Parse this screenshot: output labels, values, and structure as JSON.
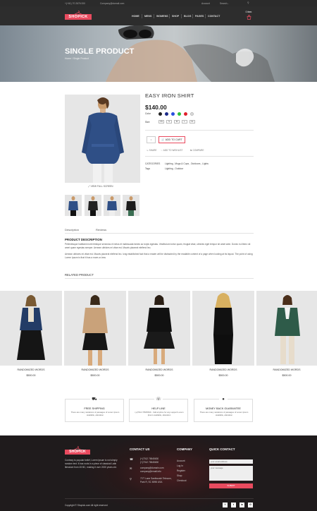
{
  "topbar": {
    "phone": "+(+61) 70 2676 000",
    "email": "Company@domail.com",
    "account": "Account",
    "search": "Search..."
  },
  "header": {
    "logo": "SHOPICK",
    "nav": [
      "HOME",
      "MENS",
      "WOMENS",
      "SHOP",
      "BLOG",
      "PAGES",
      "CONTACT"
    ],
    "cart_count": "0 item"
  },
  "hero": {
    "title": "SINGLE PRODUCT",
    "breadcrumb": "Home  /  Single Product"
  },
  "product": {
    "name": "EASY IRON SHIRT",
    "price": "$140.00",
    "color_label": "Color",
    "colors": [
      "#222222",
      "#1a2a88",
      "#2a4ee0",
      "#2cc23a",
      "#e0202a",
      "#dddddd"
    ],
    "size_label": "Size",
    "sizes": [
      "XS",
      "S",
      "M",
      "L",
      "XL"
    ],
    "qty": "1",
    "add_to_cart": "ADD TO CART",
    "share": "SHARE",
    "wishlist": "ADD TO WISHLIST",
    "compare": "COMPARE",
    "categories_label": "CATEGORIES",
    "categories_value": "Lighting , Mugs & Cups , Outdoors , Lights",
    "tags_label": "Tags",
    "tags_value": "Lighting , Outdoor",
    "view_full": "VIEW FULL SCREEN"
  },
  "tabs": [
    "Description",
    "Reviews"
  ],
  "description": {
    "title": "PRODUCT DESCRIPTION",
    "p1": "Pellentesque habitant morbi tristique senectus et netus et malesuada fames ac turpis egestas. Vestibulum tortor quam, feugiat vitae, ultricies eget tempor sit amet ante. Donec eu libero sit amet quam egestas semper. Aenean ultricies mi vitae est. Mauris placerat eleifend leo.",
    "p2": "Aenean ultricies mi vitae est. Mauris placerat eleifend leo. long established fact that a reader will be distracted by the readable content of a page when looking at its layout. The point of using Lorem Ipsum is that it has a more-or-less"
  },
  "related": {
    "heading": "RELATED PRODUCT",
    "items": [
      {
        "name": "RANDOMIZED WORDS",
        "price": "$500.00"
      },
      {
        "name": "RANDOMIZED WORDS",
        "price": "$500.00"
      },
      {
        "name": "RANDOMIZED WORDS",
        "price": "$500.00"
      },
      {
        "name": "RANDOMIZED WORDS",
        "price": "$500.00"
      },
      {
        "name": "RANDOMIZED WORDS",
        "price": "$500.00"
      }
    ]
  },
  "features": [
    {
      "title": "FREE SHIPPING",
      "desc": "There are many variations of passages of Lorem Ipsum available, alteration"
    },
    {
      "title": "HELP LINE",
      "desc": "(+)7012 76545630 - Call anytime for any support Lorem Ipsum available, alteration"
    },
    {
      "title": "MONEY BACK GUARANTEE",
      "desc": "There are many variations of passages of Lorem Ipsum available, alteration"
    }
  ],
  "footer": {
    "logo": "SHOPICK",
    "about": [
      "Contrary to popular belief, Lorem Ipsum is not simply",
      "random text. It has roots in a piece of classical Latin",
      "literature from 45 BC, making it over 2000 years old."
    ],
    "contact_head": "CONTACT US",
    "phones": [
      "(+)7012 76545630",
      "(+)7012 76545630"
    ],
    "emails": [
      "company@domain.com",
      "company@email.info"
    ],
    "address": [
      "77/7 Lane Santhoushi Telecom,",
      "Park R, SC 8098 USA"
    ],
    "company_head": "COMPANY",
    "company_links": [
      "Account",
      "Log In",
      "Register",
      "Shop",
      "Checkout"
    ],
    "quick_head": "QUICK CONTACT",
    "email_placeholder": "your email address",
    "message_placeholder": "your message",
    "submit": "SUBMIT",
    "copyright": "Copyright © Shopick.com All right reserved",
    "social": [
      "f",
      "t",
      "in",
      "G"
    ]
  },
  "colors": {
    "accent": "#e94b5f",
    "dark": "#2d2d2d",
    "footer": "#1f1b1c"
  }
}
